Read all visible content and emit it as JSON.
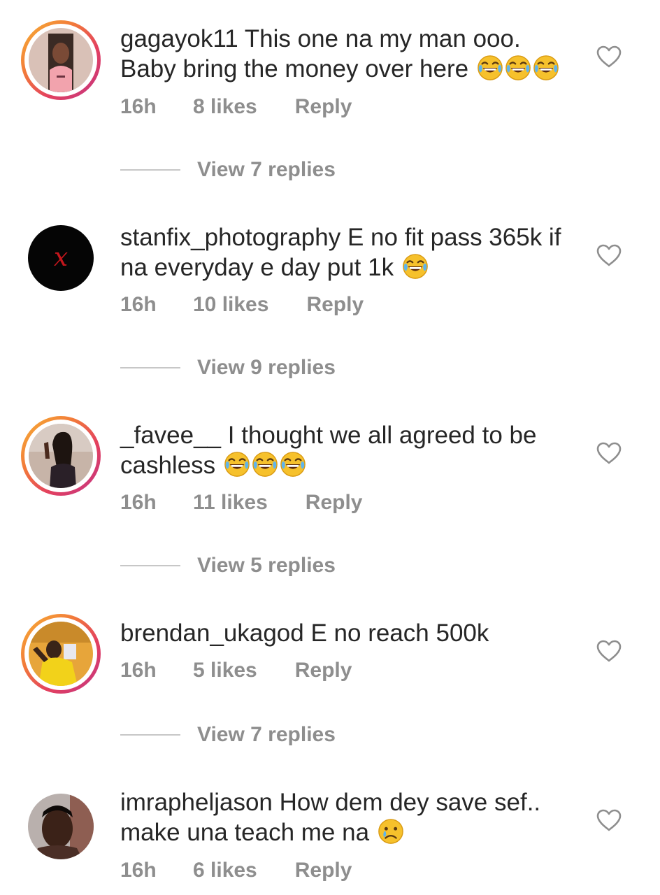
{
  "comments": [
    {
      "username": "gagayok11",
      "text": "This one na my man ooo. Baby bring the money over here",
      "emoji": "😂😂😂",
      "time": "16h",
      "likes": "8 likes",
      "reply": "Reply",
      "view_replies": "View 7 replies"
    },
    {
      "username": "stanfix_photography",
      "text": "E no fit pass 365k if na everyday e day put 1k",
      "emoji": "😂",
      "time": "16h",
      "likes": "10 likes",
      "reply": "Reply",
      "view_replies": "View 9 replies"
    },
    {
      "username": "_favee__",
      "text": "I thought we all agreed to be cashless",
      "emoji": "😂😂😂",
      "time": "16h",
      "likes": "11 likes",
      "reply": "Reply",
      "view_replies": "View 5 replies"
    },
    {
      "username": "brendan_ukagod",
      "text": "E no reach 500k",
      "emoji": "",
      "time": "16h",
      "likes": "5 likes",
      "reply": "Reply",
      "view_replies": "View 7 replies"
    },
    {
      "username": "imrapheljason",
      "text": "How dem dey save sef.. make una teach me na",
      "emoji": "😢",
      "time": "16h",
      "likes": "6 likes",
      "reply": "Reply"
    }
  ],
  "icons": {
    "heart": "heart-outline-icon",
    "avatar_ring_colors": [
      "#f7b334",
      "#e3405f",
      "#c13584"
    ],
    "meta_color": "#8e8e8e",
    "text_color": "#262626"
  }
}
